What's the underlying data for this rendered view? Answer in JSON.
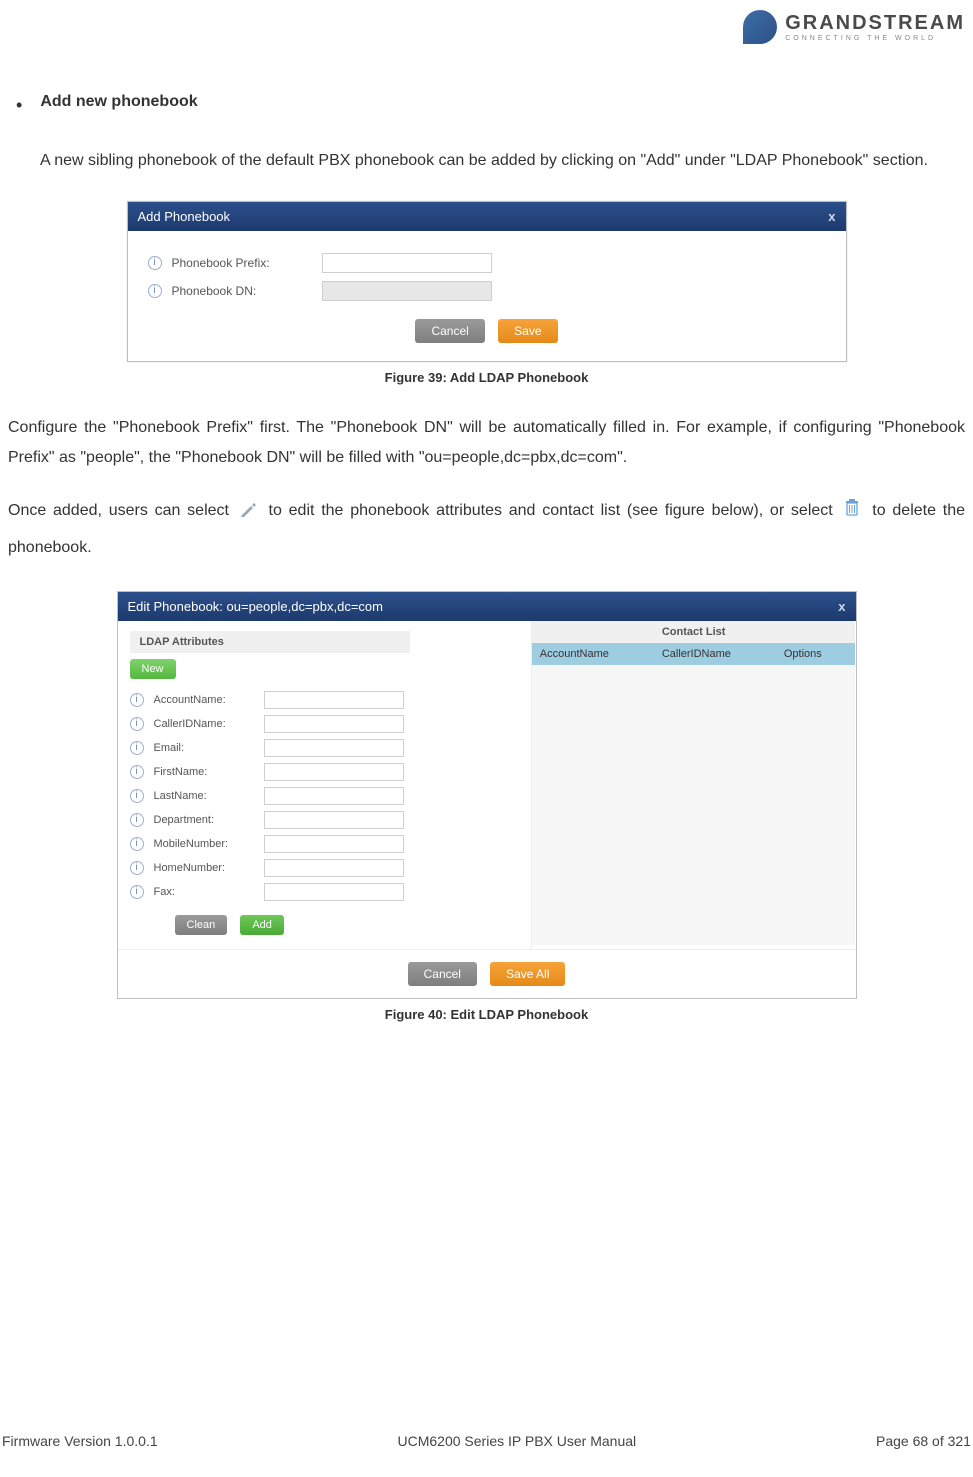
{
  "brand": {
    "name": "GRANDSTREAM",
    "tagline": "CONNECTING THE WORLD"
  },
  "section": {
    "bullet_title": "Add new phonebook",
    "para1": "A new sibling phonebook of the default PBX phonebook can be added by clicking on \"Add\" under \"LDAP Phonebook\" section.",
    "para2": "Configure the \"Phonebook Prefix\" first. The \"Phonebook DN\" will be automatically filled in. For example, if configuring \"Phonebook Prefix\" as \"people\", the \"Phonebook DN\" will be filled with \"ou=people,dc=pbx,dc=com\".",
    "para3_a": "Once added, users can select ",
    "para3_b": " to edit the phonebook attributes and contact list (see figure below), or select ",
    "para3_c": " to delete the phonebook."
  },
  "fig39": {
    "caption": "Figure 39: Add LDAP Phonebook",
    "title": "Add Phonebook",
    "close": "x",
    "row1": "Phonebook Prefix:",
    "row2": "Phonebook DN:",
    "cancel": "Cancel",
    "save": "Save"
  },
  "fig40": {
    "caption": "Figure 40: Edit LDAP Phonebook",
    "title": "Edit Phonebook: ou=people,dc=pbx,dc=com",
    "close": "x",
    "left_head": "LDAP Attributes",
    "right_head": "Contact List",
    "new": "New",
    "cols": {
      "c1": "AccountName",
      "c2": "CallerIDName",
      "c3": "Options"
    },
    "attrs": {
      "a1": "AccountName:",
      "a2": "CallerIDName:",
      "a3": "Email:",
      "a4": "FirstName:",
      "a5": "LastName:",
      "a6": "Department:",
      "a7": "MobileNumber:",
      "a8": "HomeNumber:",
      "a9": "Fax:"
    },
    "clean": "Clean",
    "add": "Add",
    "cancel": "Cancel",
    "saveall": "Save All"
  },
  "footer": {
    "left": "Firmware Version 1.0.0.1",
    "center": "UCM6200 Series IP PBX User Manual",
    "right": "Page 68 of 321"
  }
}
